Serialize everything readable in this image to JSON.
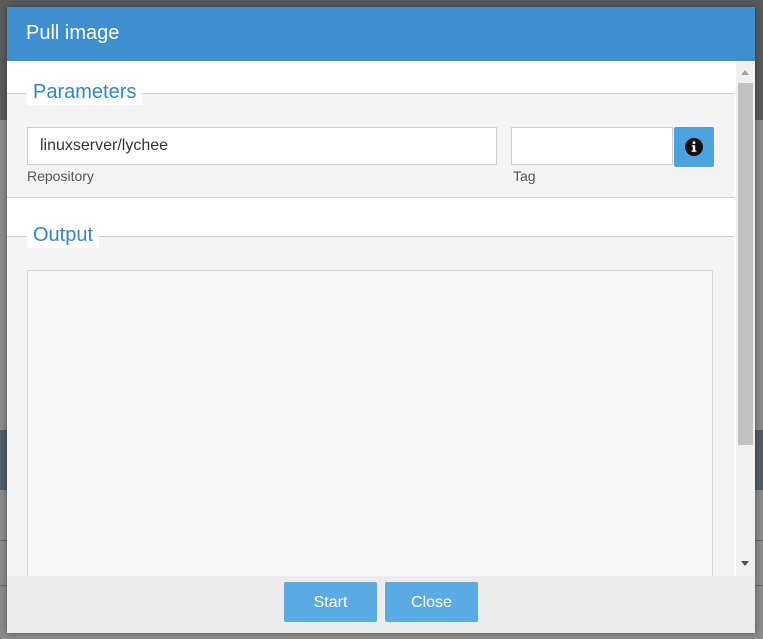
{
  "dialog": {
    "title": "Pull image",
    "parameters": {
      "legend": "Parameters",
      "repository": {
        "value": "linuxserver/lychee",
        "label": "Repository"
      },
      "tag": {
        "value": "",
        "label": "Tag"
      },
      "info_icon": "info-circle-icon"
    },
    "output": {
      "legend": "Output",
      "text": ""
    },
    "footer": {
      "start_label": "Start",
      "close_label": "Close"
    }
  },
  "colors": {
    "titlebar": "#3d8fce",
    "accent": "#2f86c4",
    "button": "#5aaae3"
  }
}
